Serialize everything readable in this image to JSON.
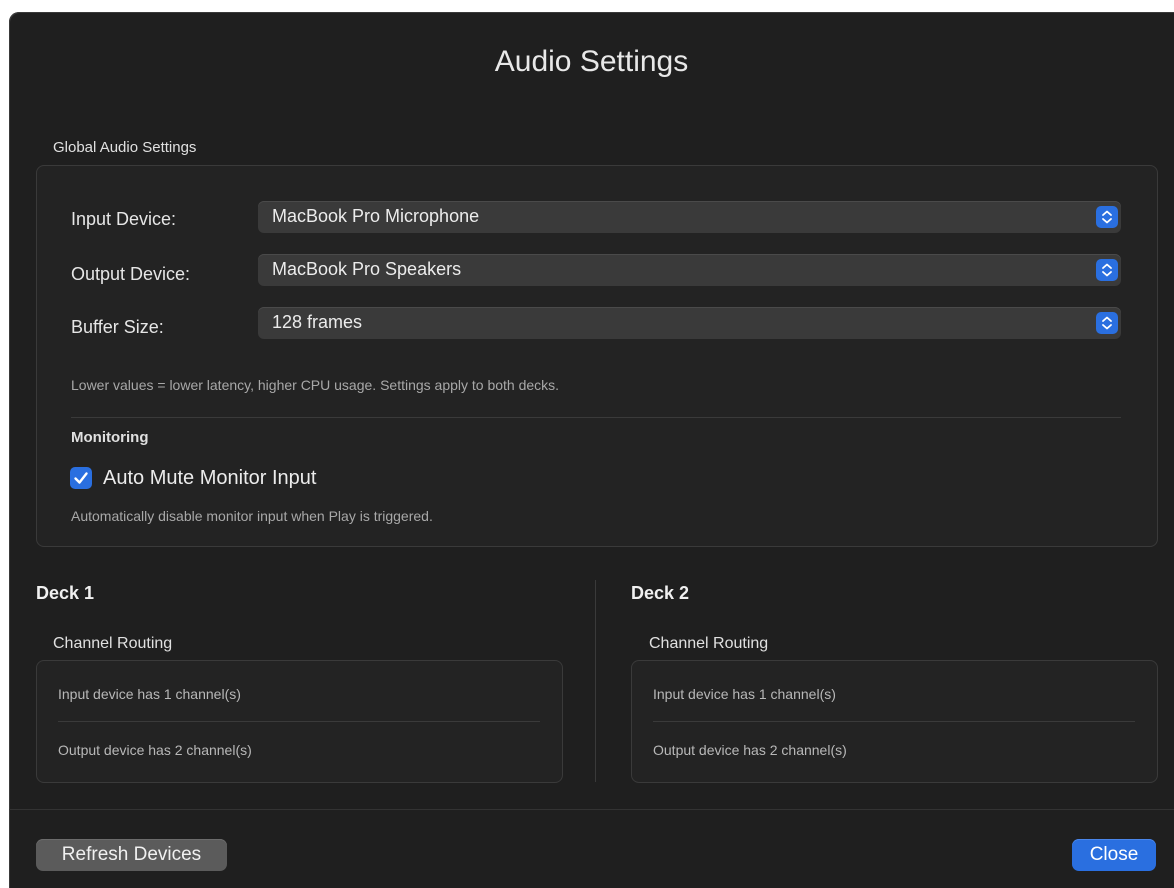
{
  "window": {
    "title": "Audio Settings"
  },
  "global": {
    "section_label": "Global Audio Settings",
    "input_device": {
      "label": "Input Device:",
      "value": "MacBook Pro Microphone"
    },
    "output_device": {
      "label": "Output Device:",
      "value": "MacBook Pro Speakers"
    },
    "buffer_size": {
      "label": "Buffer Size:",
      "value": "128 frames"
    },
    "hint": "Lower values = lower latency, higher CPU usage. Settings apply to both decks.",
    "monitoring": {
      "label": "Monitoring",
      "auto_mute": {
        "label": "Auto Mute Monitor Input",
        "checked": true
      },
      "hint": "Automatically disable monitor input when Play is triggered."
    }
  },
  "decks": [
    {
      "title": "Deck 1",
      "routing_label": "Channel Routing",
      "input_info": "Input device has 1 channel(s)",
      "output_info": "Output device has 2 channel(s)"
    },
    {
      "title": "Deck 2",
      "routing_label": "Channel Routing",
      "input_info": "Input device has 1 channel(s)",
      "output_info": "Output device has 2 channel(s)"
    }
  ],
  "footer": {
    "refresh_label": "Refresh Devices",
    "close_label": "Close"
  },
  "colors": {
    "accent": "#2a6fe0",
    "background": "#1f1f1f"
  }
}
